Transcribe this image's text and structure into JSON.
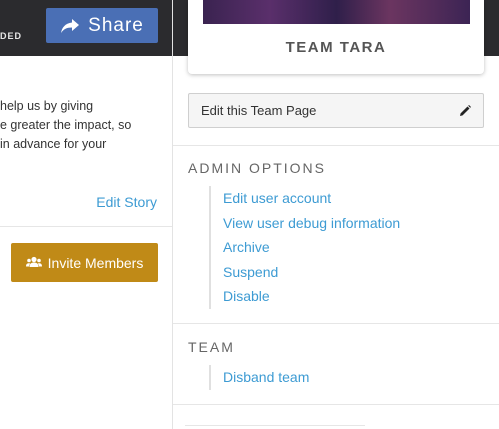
{
  "header": {
    "funded_text": "DED",
    "share_label": "Share"
  },
  "story": {
    "lines": [
      "help us by giving",
      "e greater the impact, so",
      "in advance for your"
    ],
    "edit_story_label": "Edit Story"
  },
  "invite": {
    "label": "Invite Members"
  },
  "team_card": {
    "name": "TEAM TARA"
  },
  "edit_team": {
    "label": "Edit this Team Page"
  },
  "admin": {
    "heading": "ADMIN OPTIONS",
    "links": [
      "Edit user account",
      "View user debug information",
      "Archive",
      "Suspend",
      "Disable"
    ]
  },
  "team": {
    "heading": "TEAM",
    "links": [
      "Disband team"
    ]
  },
  "colors": {
    "header_bg": "#2b2b2e",
    "share_bg": "#4a6fb5",
    "invite_bg": "#c08a17",
    "link": "#3d9bd3"
  },
  "icons": {
    "share": "share-arrow-icon",
    "invite": "users-group-icon",
    "edit": "pencil-icon"
  }
}
